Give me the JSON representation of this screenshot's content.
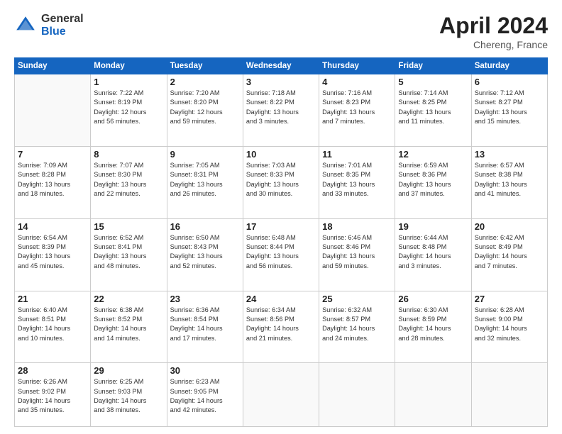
{
  "header": {
    "logo_general": "General",
    "logo_blue": "Blue",
    "title": "April 2024",
    "location": "Chereng, France"
  },
  "weekdays": [
    "Sunday",
    "Monday",
    "Tuesday",
    "Wednesday",
    "Thursday",
    "Friday",
    "Saturday"
  ],
  "weeks": [
    [
      {
        "day": "",
        "info": ""
      },
      {
        "day": "1",
        "info": "Sunrise: 7:22 AM\nSunset: 8:19 PM\nDaylight: 12 hours\nand 56 minutes."
      },
      {
        "day": "2",
        "info": "Sunrise: 7:20 AM\nSunset: 8:20 PM\nDaylight: 12 hours\nand 59 minutes."
      },
      {
        "day": "3",
        "info": "Sunrise: 7:18 AM\nSunset: 8:22 PM\nDaylight: 13 hours\nand 3 minutes."
      },
      {
        "day": "4",
        "info": "Sunrise: 7:16 AM\nSunset: 8:23 PM\nDaylight: 13 hours\nand 7 minutes."
      },
      {
        "day": "5",
        "info": "Sunrise: 7:14 AM\nSunset: 8:25 PM\nDaylight: 13 hours\nand 11 minutes."
      },
      {
        "day": "6",
        "info": "Sunrise: 7:12 AM\nSunset: 8:27 PM\nDaylight: 13 hours\nand 15 minutes."
      }
    ],
    [
      {
        "day": "7",
        "info": "Sunrise: 7:09 AM\nSunset: 8:28 PM\nDaylight: 13 hours\nand 18 minutes."
      },
      {
        "day": "8",
        "info": "Sunrise: 7:07 AM\nSunset: 8:30 PM\nDaylight: 13 hours\nand 22 minutes."
      },
      {
        "day": "9",
        "info": "Sunrise: 7:05 AM\nSunset: 8:31 PM\nDaylight: 13 hours\nand 26 minutes."
      },
      {
        "day": "10",
        "info": "Sunrise: 7:03 AM\nSunset: 8:33 PM\nDaylight: 13 hours\nand 30 minutes."
      },
      {
        "day": "11",
        "info": "Sunrise: 7:01 AM\nSunset: 8:35 PM\nDaylight: 13 hours\nand 33 minutes."
      },
      {
        "day": "12",
        "info": "Sunrise: 6:59 AM\nSunset: 8:36 PM\nDaylight: 13 hours\nand 37 minutes."
      },
      {
        "day": "13",
        "info": "Sunrise: 6:57 AM\nSunset: 8:38 PM\nDaylight: 13 hours\nand 41 minutes."
      }
    ],
    [
      {
        "day": "14",
        "info": "Sunrise: 6:54 AM\nSunset: 8:39 PM\nDaylight: 13 hours\nand 45 minutes."
      },
      {
        "day": "15",
        "info": "Sunrise: 6:52 AM\nSunset: 8:41 PM\nDaylight: 13 hours\nand 48 minutes."
      },
      {
        "day": "16",
        "info": "Sunrise: 6:50 AM\nSunset: 8:43 PM\nDaylight: 13 hours\nand 52 minutes."
      },
      {
        "day": "17",
        "info": "Sunrise: 6:48 AM\nSunset: 8:44 PM\nDaylight: 13 hours\nand 56 minutes."
      },
      {
        "day": "18",
        "info": "Sunrise: 6:46 AM\nSunset: 8:46 PM\nDaylight: 13 hours\nand 59 minutes."
      },
      {
        "day": "19",
        "info": "Sunrise: 6:44 AM\nSunset: 8:48 PM\nDaylight: 14 hours\nand 3 minutes."
      },
      {
        "day": "20",
        "info": "Sunrise: 6:42 AM\nSunset: 8:49 PM\nDaylight: 14 hours\nand 7 minutes."
      }
    ],
    [
      {
        "day": "21",
        "info": "Sunrise: 6:40 AM\nSunset: 8:51 PM\nDaylight: 14 hours\nand 10 minutes."
      },
      {
        "day": "22",
        "info": "Sunrise: 6:38 AM\nSunset: 8:52 PM\nDaylight: 14 hours\nand 14 minutes."
      },
      {
        "day": "23",
        "info": "Sunrise: 6:36 AM\nSunset: 8:54 PM\nDaylight: 14 hours\nand 17 minutes."
      },
      {
        "day": "24",
        "info": "Sunrise: 6:34 AM\nSunset: 8:56 PM\nDaylight: 14 hours\nand 21 minutes."
      },
      {
        "day": "25",
        "info": "Sunrise: 6:32 AM\nSunset: 8:57 PM\nDaylight: 14 hours\nand 24 minutes."
      },
      {
        "day": "26",
        "info": "Sunrise: 6:30 AM\nSunset: 8:59 PM\nDaylight: 14 hours\nand 28 minutes."
      },
      {
        "day": "27",
        "info": "Sunrise: 6:28 AM\nSunset: 9:00 PM\nDaylight: 14 hours\nand 32 minutes."
      }
    ],
    [
      {
        "day": "28",
        "info": "Sunrise: 6:26 AM\nSunset: 9:02 PM\nDaylight: 14 hours\nand 35 minutes."
      },
      {
        "day": "29",
        "info": "Sunrise: 6:25 AM\nSunset: 9:03 PM\nDaylight: 14 hours\nand 38 minutes."
      },
      {
        "day": "30",
        "info": "Sunrise: 6:23 AM\nSunset: 9:05 PM\nDaylight: 14 hours\nand 42 minutes."
      },
      {
        "day": "",
        "info": ""
      },
      {
        "day": "",
        "info": ""
      },
      {
        "day": "",
        "info": ""
      },
      {
        "day": "",
        "info": ""
      }
    ]
  ]
}
